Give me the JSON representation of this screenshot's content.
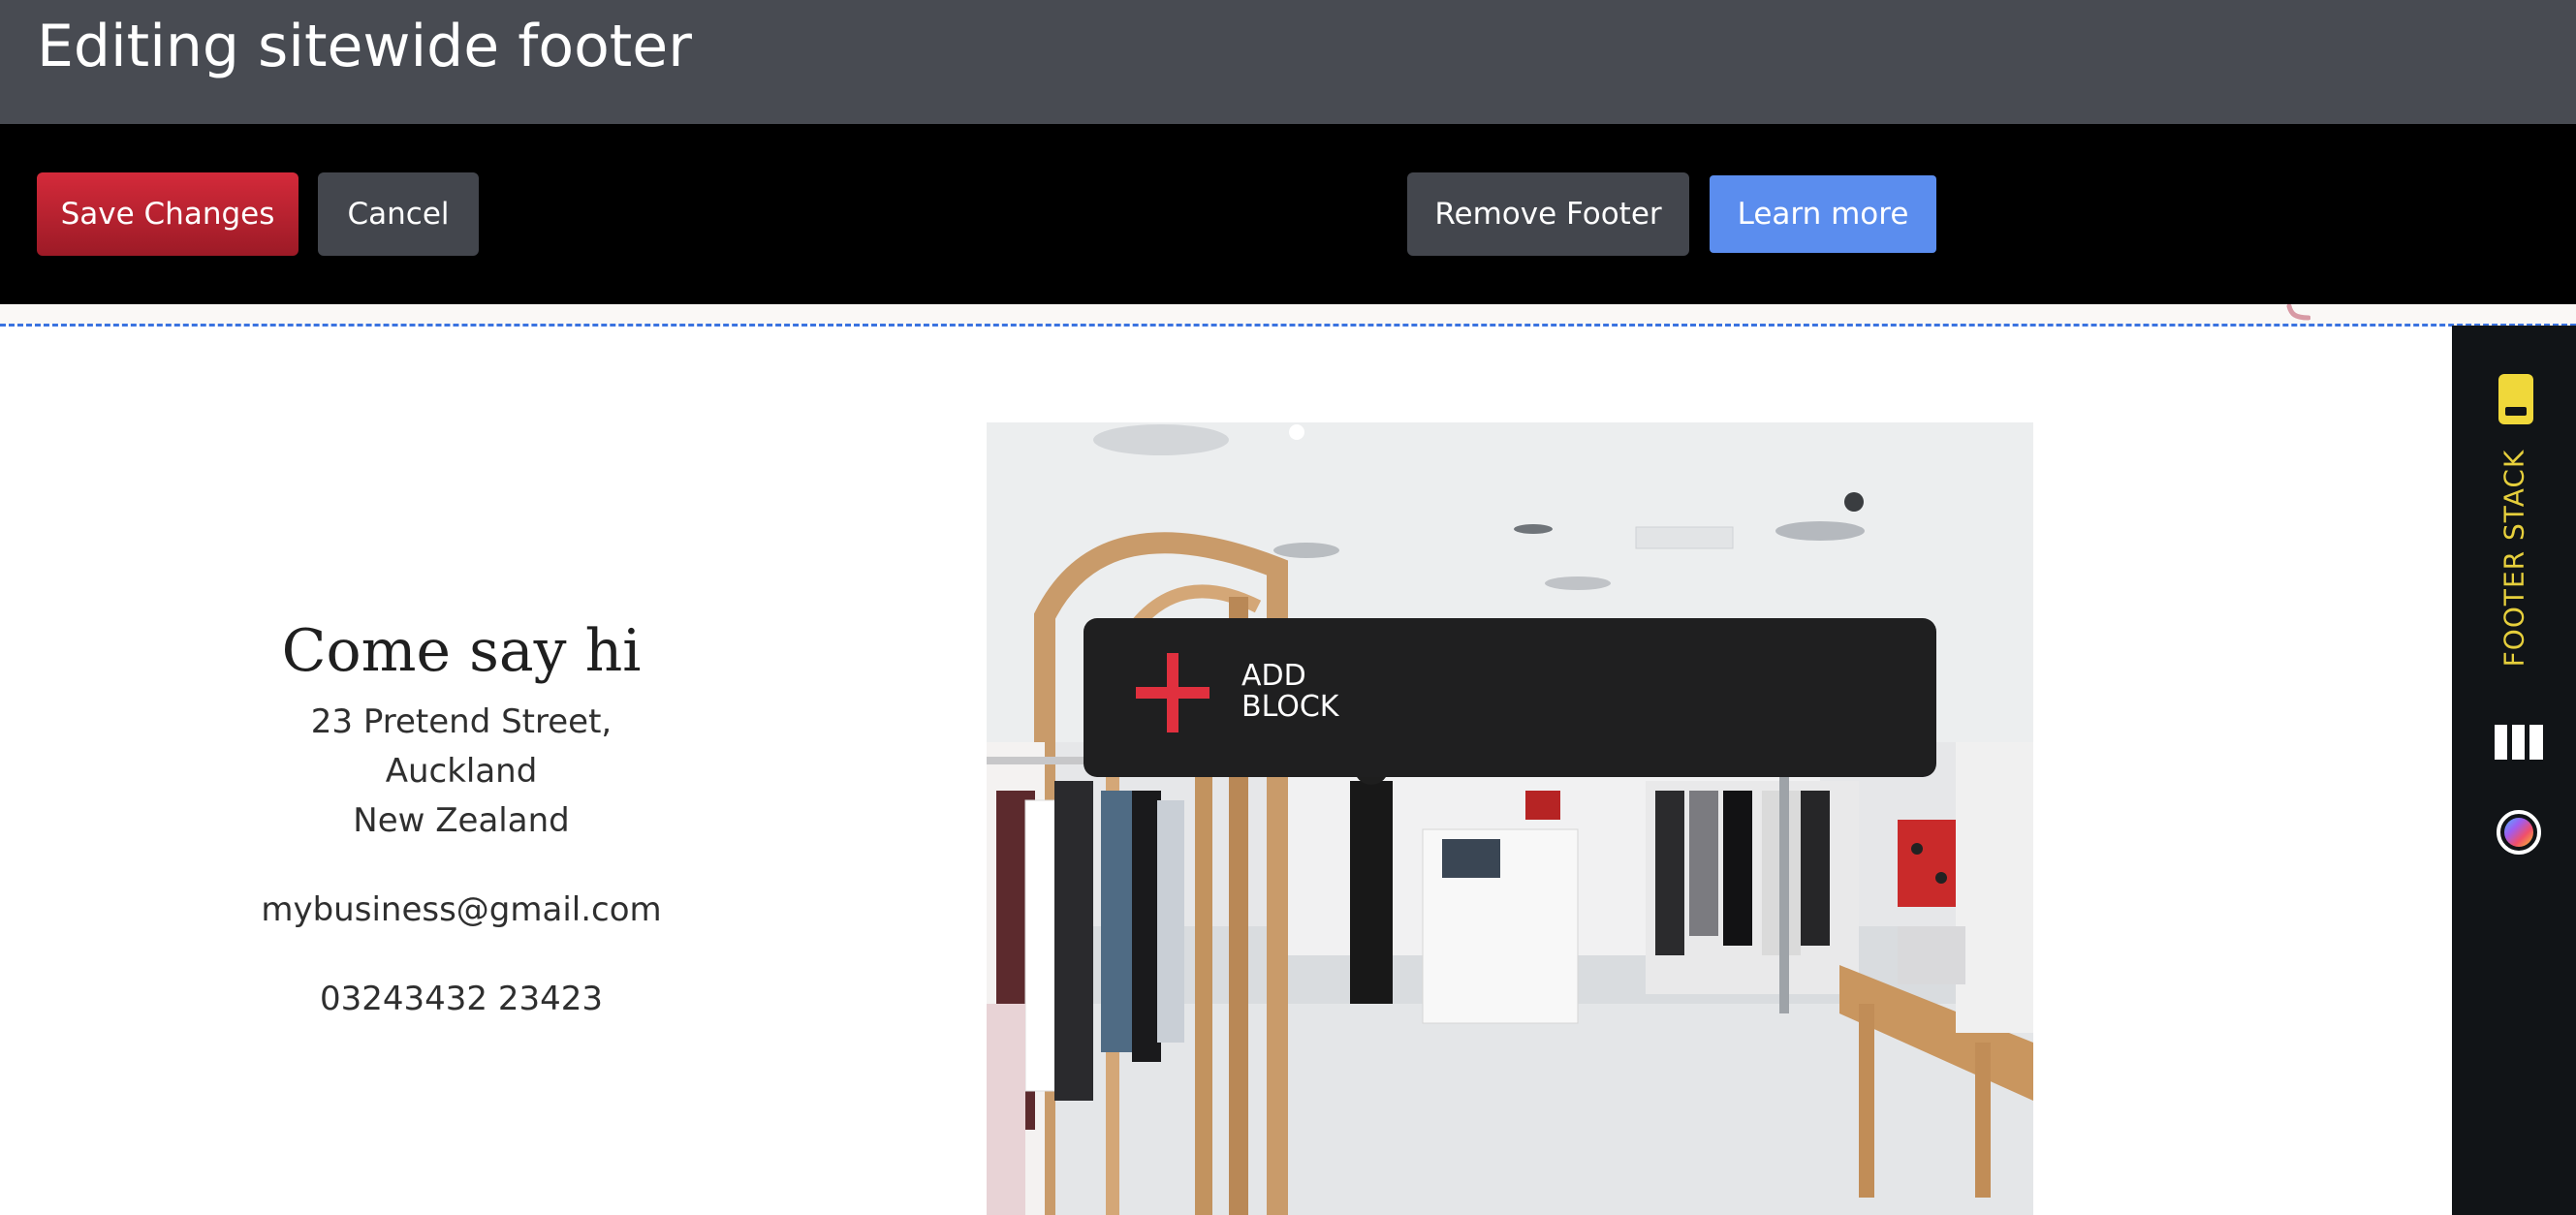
{
  "header": {
    "title": "Editing sitewide footer"
  },
  "toolbar": {
    "save_label": "Save Changes",
    "cancel_label": "Cancel",
    "remove_label": "Remove Footer",
    "learn_label": "Learn more"
  },
  "footer": {
    "heading": "Come say hi",
    "address_lines": [
      "23 Pretend Street,",
      "Auckland",
      "New Zealand"
    ],
    "email": "mybusiness@gmail.com",
    "phone": "03243432 23423"
  },
  "add_block": {
    "icon": "plus-icon",
    "line1": "ADD",
    "line2": "BLOCK"
  },
  "sidebar": {
    "label": "FOOTER STACK",
    "icons": [
      "footer-stack-icon",
      "columns-icon",
      "color-palette-icon"
    ]
  },
  "colors": {
    "title_bar": "#484b52",
    "toolbar": "#000000",
    "save_button": "#c02231",
    "secondary_button": "#43464d",
    "learn_button": "#5b8dee",
    "add_block_bg": "#1f1f20",
    "add_plus": "#e0303e",
    "sidebar_bg": "#111417",
    "sidebar_accent": "#e6cf3c",
    "dashed_line": "#3b73e0"
  }
}
